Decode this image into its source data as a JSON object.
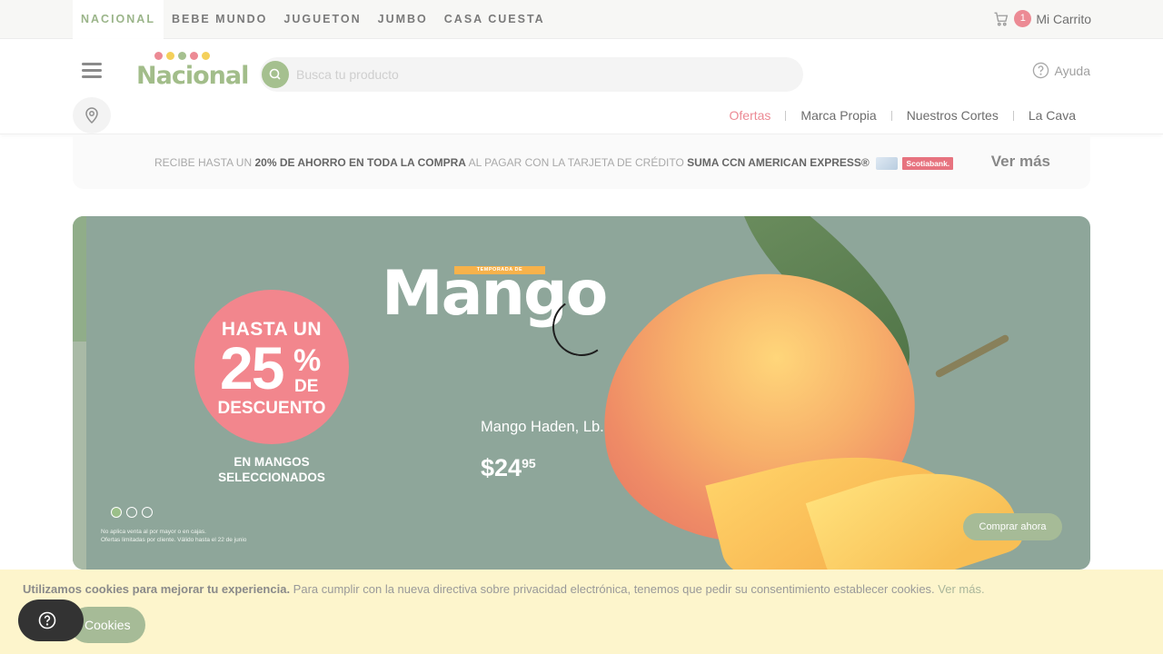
{
  "top_bar": {
    "brands": [
      "NACIONAL",
      "BEBE MUNDO",
      "JUGUETON",
      "JUMBO",
      "CASA CUESTA"
    ],
    "cart_count": "1",
    "cart_label": "Mi Carrito"
  },
  "header": {
    "logo_text": "Nacional",
    "search_placeholder": "Busca tu producto",
    "help_label": "Ayuda",
    "nav_links": [
      "Ofertas",
      "Marca Propia",
      "Nuestros Cortes",
      "La Cava"
    ]
  },
  "promo": {
    "text_1": "RECIBE HASTA UN ",
    "text_bold_1": "20% DE AHORRO EN TODA LA COMPRA",
    "text_2": " AL PAGAR CON LA TARJETA DE CRÉDITO ",
    "text_bold_2": "SUMA CCN AMERICAN EXPRESS®",
    "bank": "Scotiabank.",
    "link": "Ver más"
  },
  "hero": {
    "discount_top": "HASTA UN",
    "discount_number": "25",
    "discount_percent": "%",
    "discount_de": "DE",
    "discount_bottom": "DESCUENTO",
    "discount_sub": "EN MANGOS SELECCIONADOS",
    "season_label": "TEMPORADA DE",
    "title": "Mango",
    "product_name": "Mango Haden, Lb.",
    "price_main": "$24",
    "price_cents": "95",
    "disclaimer_1": "No aplica venta al por mayor o en cajas.",
    "disclaimer_2": "Ofertas limitadas por cliente. Válido hasta el 22 de junio",
    "cta": "Comprar ahora",
    "slide_count": 3,
    "active_slide": 1
  },
  "cookies": {
    "bold": "Utilizamos cookies para mejorar tu experiencia.",
    "text": " Para cumplir con la nueva directiva sobre privacidad electrónica, tenemos que pedir su consentimiento establecer cookies. ",
    "link": "Ver más.",
    "button": "Cookies"
  },
  "colors": {
    "accent_green": "#a2bd8a",
    "accent_pink": "#ec8a94",
    "hero_bg": "#8ea69a",
    "cookie_bg": "#fdf5cc"
  }
}
